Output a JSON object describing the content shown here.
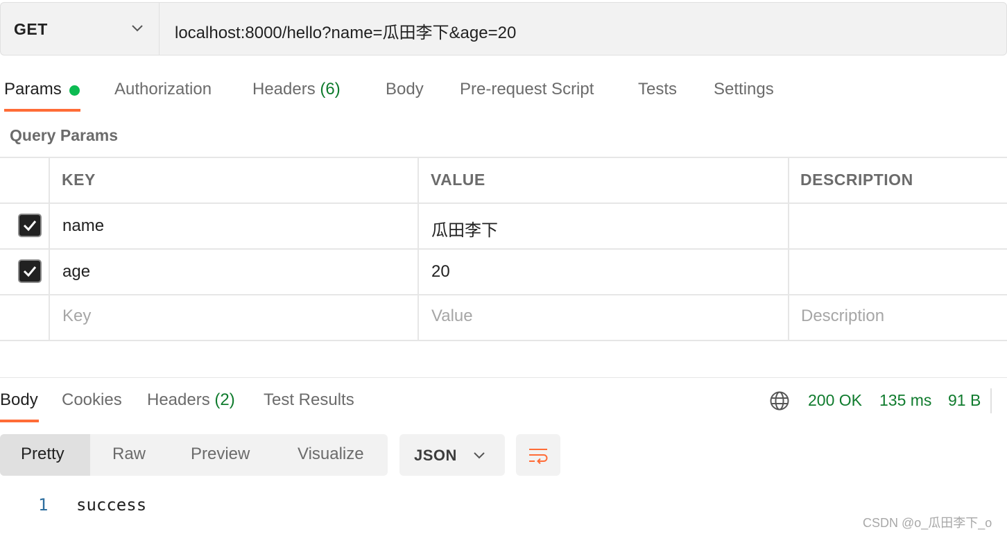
{
  "request": {
    "method": "GET",
    "url": "localhost:8000/hello?name=瓜田李下&age=20"
  },
  "request_tabs": [
    {
      "label": "Params",
      "active": true,
      "has_dot": true
    },
    {
      "label": "Authorization"
    },
    {
      "label": "Headers",
      "count": "(6)"
    },
    {
      "label": "Body"
    },
    {
      "label": "Pre-request Script"
    },
    {
      "label": "Tests"
    },
    {
      "label": "Settings"
    }
  ],
  "query_params": {
    "title": "Query Params",
    "headers": {
      "key": "KEY",
      "value": "VALUE",
      "description": "DESCRIPTION"
    },
    "rows": [
      {
        "checked": true,
        "key": "name",
        "value": "瓜田李下",
        "description": ""
      },
      {
        "checked": true,
        "key": "age",
        "value": "20",
        "description": ""
      }
    ],
    "placeholders": {
      "key": "Key",
      "value": "Value",
      "description": "Description"
    }
  },
  "response_tabs": [
    {
      "label": "Body",
      "active": true
    },
    {
      "label": "Cookies"
    },
    {
      "label": "Headers",
      "count": "(2)"
    },
    {
      "label": "Test Results"
    }
  ],
  "response_status": {
    "status": "200 OK",
    "time": "135 ms",
    "size": "91 B",
    "icon": "globe-icon"
  },
  "view_modes": [
    {
      "label": "Pretty",
      "active": true
    },
    {
      "label": "Raw"
    },
    {
      "label": "Preview"
    },
    {
      "label": "Visualize"
    }
  ],
  "format": {
    "selected": "JSON",
    "wrap_icon": "wrap-lines-icon"
  },
  "response_body": {
    "line_number": "1",
    "text": "success"
  },
  "watermark": "CSDN @o_瓜田李下_o",
  "colors": {
    "accent": "#ff6c37",
    "success": "#0f7b2d",
    "dot": "#0cbb52"
  }
}
